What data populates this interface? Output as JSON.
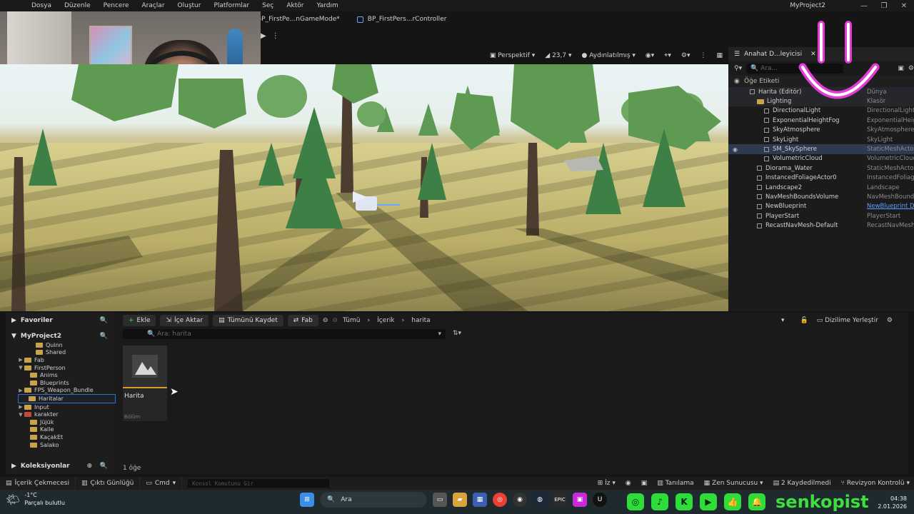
{
  "menu": [
    "Dosya",
    "Düzenle",
    "Pencere",
    "Araçlar",
    "Oluştur",
    "Platformlar",
    "Seç",
    "Aktör",
    "Yardım"
  ],
  "window": {
    "project": "MyProject2",
    "min": "—",
    "max": "❐",
    "close": "✕"
  },
  "tabs": [
    "BP_FirstPe...nGameMode*",
    "BP_FirstPers...rController"
  ],
  "viewport_bar": {
    "perspective": "Perspektif",
    "fov": "23,7",
    "lit": "Aydınlatılmış"
  },
  "outliner": {
    "title": "Anahat D...leyicisi",
    "search_placeholder": "Ara...",
    "column": "Öğe Etiketi",
    "rows": [
      {
        "label": "Harita (Editör)",
        "type": "Dünya",
        "indent": 1
      },
      {
        "label": "Lighting",
        "type": "Klasör",
        "indent": 2
      },
      {
        "label": "DirectionalLight",
        "type": "DirectionalLight",
        "indent": 3
      },
      {
        "label": "ExponentialHeightFog",
        "type": "ExponentialHeigh",
        "indent": 3
      },
      {
        "label": "SkyAtmosphere",
        "type": "SkyAtmosphere",
        "indent": 3
      },
      {
        "label": "SkyLight",
        "type": "SkyLight",
        "indent": 3
      },
      {
        "label": "SM_SkySphere",
        "type": "StaticMeshActor",
        "indent": 3
      },
      {
        "label": "VolumetricCloud",
        "type": "VolumetricCloud",
        "indent": 3
      },
      {
        "label": "Diorama_Water",
        "type": "StaticMeshActor",
        "indent": 2
      },
      {
        "label": "InstancedFoliageActor0",
        "type": "InstancedFoliage",
        "indent": 2
      },
      {
        "label": "Landscape2",
        "type": "Landscape",
        "indent": 2
      },
      {
        "label": "NavMeshBoundsVolume",
        "type": "NavMeshBounds",
        "indent": 2
      },
      {
        "label": "NewBlueprint",
        "type": "NewBlueprint Dü",
        "indent": 2
      },
      {
        "label": "PlayerStart",
        "type": "PlayerStart",
        "indent": 2
      },
      {
        "label": "RecastNavMesh-Default",
        "type": "RecastNavMesh",
        "indent": 2
      }
    ]
  },
  "content_browser": {
    "favorites": "Favoriler",
    "project": "MyProject2",
    "collections": "Koleksiyonlar",
    "folders": [
      {
        "label": "Quinn",
        "indent": 4,
        "arrow": ""
      },
      {
        "label": "Shared",
        "indent": 4,
        "arrow": ""
      },
      {
        "label": "Fab",
        "indent": 2,
        "arrow": "▶"
      },
      {
        "label": "FirstPerson",
        "indent": 2,
        "arrow": "▼"
      },
      {
        "label": "Anims",
        "indent": 3,
        "arrow": ""
      },
      {
        "label": "Blueprints",
        "indent": 3,
        "arrow": ""
      },
      {
        "label": "FPS_Weapon_Bundle",
        "indent": 2,
        "arrow": "▶"
      },
      {
        "label": "Haritalar",
        "indent": 2,
        "arrow": "",
        "selected": true
      },
      {
        "label": "Input",
        "indent": 2,
        "arrow": "▶"
      },
      {
        "label": "karakter",
        "indent": 2,
        "arrow": "▼"
      },
      {
        "label": "Jüjük",
        "indent": 3,
        "arrow": ""
      },
      {
        "label": "Kalle",
        "indent": 3,
        "arrow": ""
      },
      {
        "label": "KaçakEt",
        "indent": 3,
        "arrow": ""
      },
      {
        "label": "Salako",
        "indent": 3,
        "arrow": ""
      }
    ],
    "buttons": {
      "add": "Ekle",
      "import": "İçe Aktar",
      "save_all": "Tümünü Kaydet",
      "fab": "Fab"
    },
    "path": [
      "Tümü",
      "İçerik",
      "harita"
    ],
    "dock": "Dizilime Yerleştir",
    "search_placeholder": "Ara: harita",
    "asset": {
      "name": "Harita",
      "kind": "Bölüm"
    },
    "count": "1 öğe"
  },
  "status": {
    "drawer": "İçerik Çekmecesi",
    "log": "Çıktı Günlüğü",
    "cmd": "Cmd",
    "console_placeholder": "Konsol Komutunu Gir",
    "trace": "Tanılama",
    "zen": "Zen Sunucusu",
    "saved": "2 Kaydedilmedi",
    "revision": "Revizyon Kontrolü"
  },
  "taskbar": {
    "temp": "-1°C",
    "weather": "Parçalı bulutlu",
    "search": "Ara",
    "brand": "senkopist",
    "time": "04:38",
    "date": "2.01.2026"
  },
  "colors": {
    "accent": "#d79b2a",
    "brand": "#3ddf3e",
    "smiley": "#e23bd6"
  }
}
